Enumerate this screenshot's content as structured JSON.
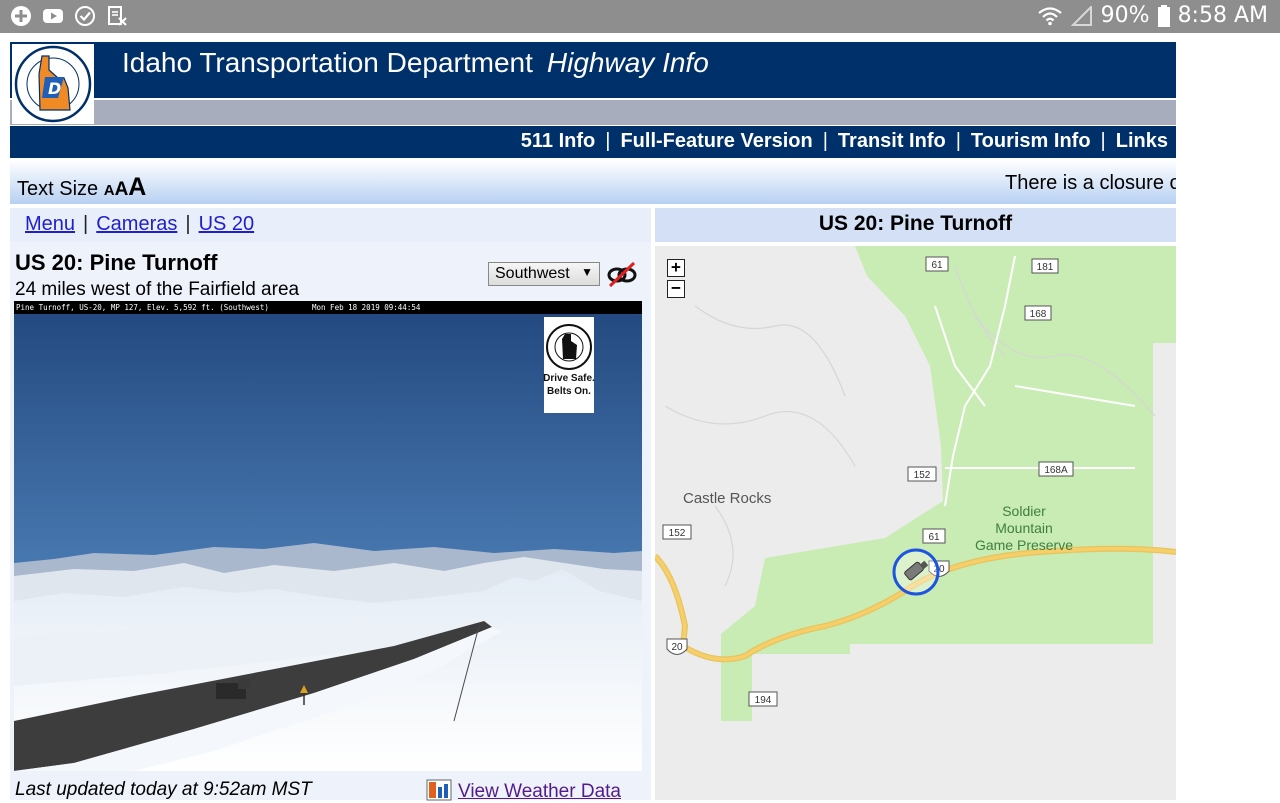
{
  "status_bar": {
    "battery": "90%",
    "time": "8:58 AM"
  },
  "header": {
    "title": "Idaho Transportation Department",
    "subtitle": "Highway Info"
  },
  "nav": {
    "links": [
      "511 Info",
      "Full-Feature Version",
      "Transit Info",
      "Tourism Info",
      "Links"
    ],
    "separator": "|"
  },
  "text_size": {
    "label": "Text Size",
    "sizes": [
      "A",
      "A",
      "A"
    ]
  },
  "ticker": "There is a closure on",
  "breadcrumbs": {
    "items": [
      "Menu",
      "Cameras",
      "US 20"
    ],
    "separator": "|"
  },
  "camera": {
    "title": "US 20: Pine Turnoff",
    "description": "24 miles west of the Fairfield area",
    "direction": "Southwest",
    "direction_arrow": "▼",
    "overlay_text": "Pine Turnoff, US-20, MP 127, Elev. 5,592 ft. (Southwest)",
    "overlay_timestamp": "Mon Feb 18 2019 09:44:54",
    "sign_line1": "Drive Safe.",
    "sign_line2": "Belts On.",
    "last_updated": "Last updated today at 9:52am MST",
    "weather_link": "View Weather Data"
  },
  "map": {
    "title": "US 20: Pine Turnoff",
    "zoom_in": "+",
    "zoom_out": "−",
    "place_labels": {
      "castle_rocks": "Castle Rocks",
      "preserve_1": "Soldier",
      "preserve_2": "Mountain",
      "preserve_3": "Game Preserve"
    },
    "route_shields": {
      "r61a": "61",
      "r181": "181",
      "r168": "168",
      "r152a": "152",
      "r168a": "168A",
      "r152b": "152",
      "r61b": "61",
      "r20a": "20",
      "r20b": "20",
      "r194": "194"
    }
  },
  "colors": {
    "brand_navy": "#00306a",
    "map_green": "#c8ecb3",
    "map_land": "#ececec",
    "highway": "#f6cf6a",
    "marker": "#1e55e0"
  }
}
